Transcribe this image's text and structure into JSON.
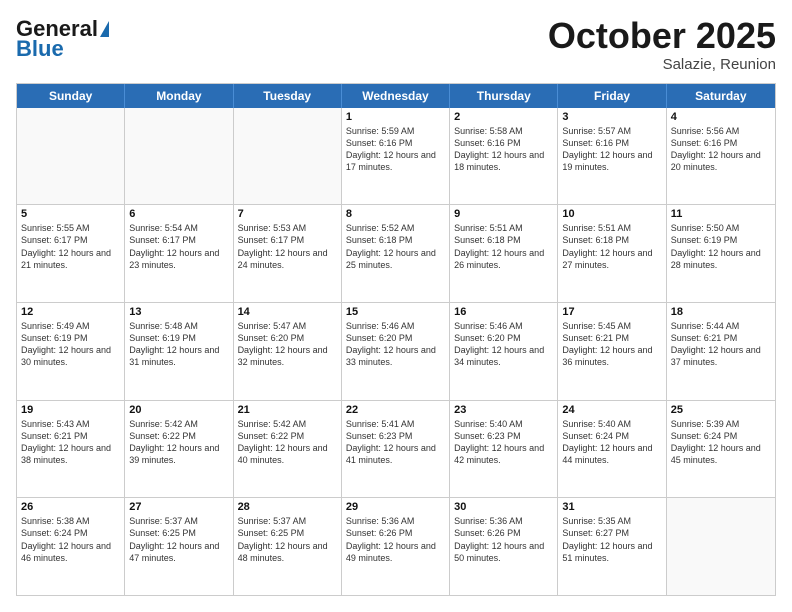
{
  "header": {
    "logo_general": "General",
    "logo_blue": "Blue",
    "title": "October 2025",
    "location": "Salazie, Reunion"
  },
  "days_of_week": [
    "Sunday",
    "Monday",
    "Tuesday",
    "Wednesday",
    "Thursday",
    "Friday",
    "Saturday"
  ],
  "weeks": [
    [
      {
        "day": "",
        "info": ""
      },
      {
        "day": "",
        "info": ""
      },
      {
        "day": "",
        "info": ""
      },
      {
        "day": "1",
        "info": "Sunrise: 5:59 AM\nSunset: 6:16 PM\nDaylight: 12 hours and 17 minutes."
      },
      {
        "day": "2",
        "info": "Sunrise: 5:58 AM\nSunset: 6:16 PM\nDaylight: 12 hours and 18 minutes."
      },
      {
        "day": "3",
        "info": "Sunrise: 5:57 AM\nSunset: 6:16 PM\nDaylight: 12 hours and 19 minutes."
      },
      {
        "day": "4",
        "info": "Sunrise: 5:56 AM\nSunset: 6:16 PM\nDaylight: 12 hours and 20 minutes."
      }
    ],
    [
      {
        "day": "5",
        "info": "Sunrise: 5:55 AM\nSunset: 6:17 PM\nDaylight: 12 hours and 21 minutes."
      },
      {
        "day": "6",
        "info": "Sunrise: 5:54 AM\nSunset: 6:17 PM\nDaylight: 12 hours and 23 minutes."
      },
      {
        "day": "7",
        "info": "Sunrise: 5:53 AM\nSunset: 6:17 PM\nDaylight: 12 hours and 24 minutes."
      },
      {
        "day": "8",
        "info": "Sunrise: 5:52 AM\nSunset: 6:18 PM\nDaylight: 12 hours and 25 minutes."
      },
      {
        "day": "9",
        "info": "Sunrise: 5:51 AM\nSunset: 6:18 PM\nDaylight: 12 hours and 26 minutes."
      },
      {
        "day": "10",
        "info": "Sunrise: 5:51 AM\nSunset: 6:18 PM\nDaylight: 12 hours and 27 minutes."
      },
      {
        "day": "11",
        "info": "Sunrise: 5:50 AM\nSunset: 6:19 PM\nDaylight: 12 hours and 28 minutes."
      }
    ],
    [
      {
        "day": "12",
        "info": "Sunrise: 5:49 AM\nSunset: 6:19 PM\nDaylight: 12 hours and 30 minutes."
      },
      {
        "day": "13",
        "info": "Sunrise: 5:48 AM\nSunset: 6:19 PM\nDaylight: 12 hours and 31 minutes."
      },
      {
        "day": "14",
        "info": "Sunrise: 5:47 AM\nSunset: 6:20 PM\nDaylight: 12 hours and 32 minutes."
      },
      {
        "day": "15",
        "info": "Sunrise: 5:46 AM\nSunset: 6:20 PM\nDaylight: 12 hours and 33 minutes."
      },
      {
        "day": "16",
        "info": "Sunrise: 5:46 AM\nSunset: 6:20 PM\nDaylight: 12 hours and 34 minutes."
      },
      {
        "day": "17",
        "info": "Sunrise: 5:45 AM\nSunset: 6:21 PM\nDaylight: 12 hours and 36 minutes."
      },
      {
        "day": "18",
        "info": "Sunrise: 5:44 AM\nSunset: 6:21 PM\nDaylight: 12 hours and 37 minutes."
      }
    ],
    [
      {
        "day": "19",
        "info": "Sunrise: 5:43 AM\nSunset: 6:21 PM\nDaylight: 12 hours and 38 minutes."
      },
      {
        "day": "20",
        "info": "Sunrise: 5:42 AM\nSunset: 6:22 PM\nDaylight: 12 hours and 39 minutes."
      },
      {
        "day": "21",
        "info": "Sunrise: 5:42 AM\nSunset: 6:22 PM\nDaylight: 12 hours and 40 minutes."
      },
      {
        "day": "22",
        "info": "Sunrise: 5:41 AM\nSunset: 6:23 PM\nDaylight: 12 hours and 41 minutes."
      },
      {
        "day": "23",
        "info": "Sunrise: 5:40 AM\nSunset: 6:23 PM\nDaylight: 12 hours and 42 minutes."
      },
      {
        "day": "24",
        "info": "Sunrise: 5:40 AM\nSunset: 6:24 PM\nDaylight: 12 hours and 44 minutes."
      },
      {
        "day": "25",
        "info": "Sunrise: 5:39 AM\nSunset: 6:24 PM\nDaylight: 12 hours and 45 minutes."
      }
    ],
    [
      {
        "day": "26",
        "info": "Sunrise: 5:38 AM\nSunset: 6:24 PM\nDaylight: 12 hours and 46 minutes."
      },
      {
        "day": "27",
        "info": "Sunrise: 5:37 AM\nSunset: 6:25 PM\nDaylight: 12 hours and 47 minutes."
      },
      {
        "day": "28",
        "info": "Sunrise: 5:37 AM\nSunset: 6:25 PM\nDaylight: 12 hours and 48 minutes."
      },
      {
        "day": "29",
        "info": "Sunrise: 5:36 AM\nSunset: 6:26 PM\nDaylight: 12 hours and 49 minutes."
      },
      {
        "day": "30",
        "info": "Sunrise: 5:36 AM\nSunset: 6:26 PM\nDaylight: 12 hours and 50 minutes."
      },
      {
        "day": "31",
        "info": "Sunrise: 5:35 AM\nSunset: 6:27 PM\nDaylight: 12 hours and 51 minutes."
      },
      {
        "day": "",
        "info": ""
      }
    ]
  ]
}
